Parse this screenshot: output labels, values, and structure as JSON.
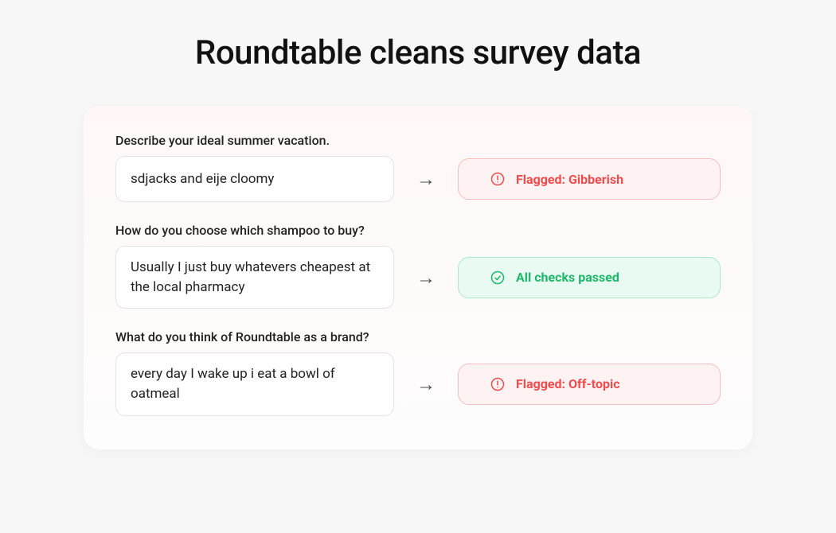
{
  "headline": "Roundtable cleans survey data",
  "rows": [
    {
      "question": "Describe your ideal summer vacation.",
      "response": "sdjacks and eije cloomy",
      "status_kind": "flagged",
      "status_label": "Flagged: Gibberish"
    },
    {
      "question": "How do you choose which shampoo to buy?",
      "response": "Usually I just buy whatevers cheapest at the local pharmacy",
      "status_kind": "passed",
      "status_label": "All checks passed"
    },
    {
      "question": "What do you think of Roundtable as a brand?",
      "response": "every day I wake up i eat a bowl of oatmeal",
      "status_kind": "flagged",
      "status_label": "Flagged: Off-topic"
    }
  ],
  "arrow_glyph": "→"
}
